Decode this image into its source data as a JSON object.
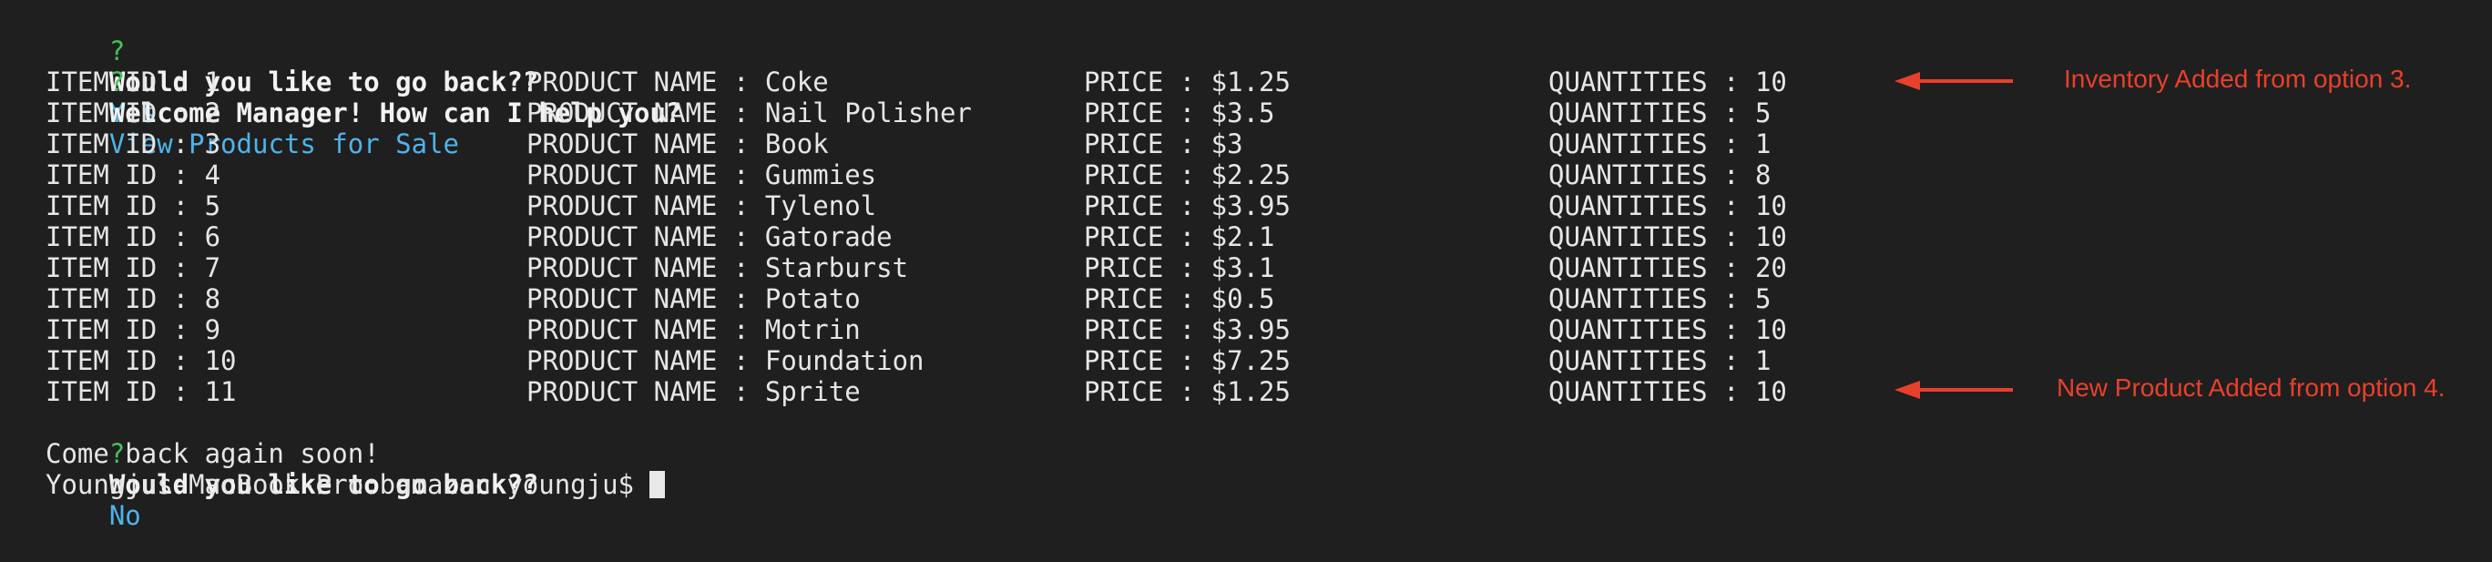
{
  "colors": {
    "background": "#1f1f1f",
    "text": "#e6e6e6",
    "prompt_mark": "#45c45a",
    "answer": "#4fb3e8",
    "annotation": "#e8402c"
  },
  "terminal": {
    "prompt_mark": "?",
    "q1": {
      "question": "Would you like to go back??",
      "answer": "Yes"
    },
    "q2": {
      "question": "Welcome Manager! How can I help you?",
      "answer": "View Products for Sale"
    },
    "rows": [
      {
        "id": "ITEM ID : 1",
        "name": "PRODUCT NAME : Coke",
        "price": "PRICE : $1.25",
        "qty": "QUANTITIES : 10"
      },
      {
        "id": "ITEM ID : 2",
        "name": "PRODUCT NAME : Nail Polisher",
        "price": "PRICE : $3.5",
        "qty": "QUANTITIES : 5"
      },
      {
        "id": "ITEM ID : 3",
        "name": "PRODUCT NAME : Book",
        "price": "PRICE : $3",
        "qty": "QUANTITIES : 1"
      },
      {
        "id": "ITEM ID : 4",
        "name": "PRODUCT NAME : Gummies",
        "price": "PRICE : $2.25",
        "qty": "QUANTITIES : 8"
      },
      {
        "id": "ITEM ID : 5",
        "name": "PRODUCT NAME : Tylenol",
        "price": "PRICE : $3.95",
        "qty": "QUANTITIES : 10"
      },
      {
        "id": "ITEM ID : 6",
        "name": "PRODUCT NAME : Gatorade",
        "price": "PRICE : $2.1",
        "qty": "QUANTITIES : 10"
      },
      {
        "id": "ITEM ID : 7",
        "name": "PRODUCT NAME : Starburst",
        "price": "PRICE : $3.1",
        "qty": "QUANTITIES : 20"
      },
      {
        "id": "ITEM ID : 8",
        "name": "PRODUCT NAME : Potato",
        "price": "PRICE : $0.5",
        "qty": "QUANTITIES : 5"
      },
      {
        "id": "ITEM ID : 9",
        "name": "PRODUCT NAME : Motrin",
        "price": "PRICE : $3.95",
        "qty": "QUANTITIES : 10"
      },
      {
        "id": "ITEM ID : 10",
        "name": "PRODUCT NAME : Foundation",
        "price": "PRICE : $7.25",
        "qty": "QUANTITIES : 1"
      },
      {
        "id": "ITEM ID : 11",
        "name": "PRODUCT NAME : Sprite",
        "price": "PRICE : $1.25",
        "qty": "QUANTITIES : 10"
      }
    ],
    "q3": {
      "question": "Would you like to go back??",
      "answer": "No"
    },
    "farewell": "Come back again soon!",
    "shell_prompt": "Youngjus-MacBook-Pro:bamazon youngju$ "
  },
  "annotations": [
    {
      "text": "Inventory Added from option 3."
    },
    {
      "text": "New Product Added from option 4."
    }
  ]
}
